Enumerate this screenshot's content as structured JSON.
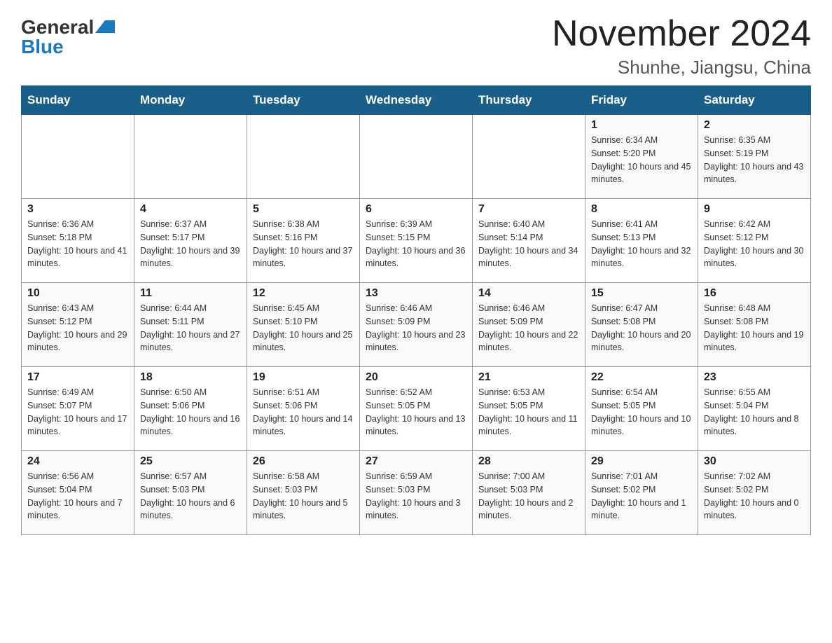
{
  "logo": {
    "general": "General",
    "blue": "Blue"
  },
  "header": {
    "month_year": "November 2024",
    "location": "Shunhe, Jiangsu, China"
  },
  "days_of_week": [
    "Sunday",
    "Monday",
    "Tuesday",
    "Wednesday",
    "Thursday",
    "Friday",
    "Saturday"
  ],
  "weeks": [
    [
      {
        "day": "",
        "info": ""
      },
      {
        "day": "",
        "info": ""
      },
      {
        "day": "",
        "info": ""
      },
      {
        "day": "",
        "info": ""
      },
      {
        "day": "",
        "info": ""
      },
      {
        "day": "1",
        "info": "Sunrise: 6:34 AM\nSunset: 5:20 PM\nDaylight: 10 hours and 45 minutes."
      },
      {
        "day": "2",
        "info": "Sunrise: 6:35 AM\nSunset: 5:19 PM\nDaylight: 10 hours and 43 minutes."
      }
    ],
    [
      {
        "day": "3",
        "info": "Sunrise: 6:36 AM\nSunset: 5:18 PM\nDaylight: 10 hours and 41 minutes."
      },
      {
        "day": "4",
        "info": "Sunrise: 6:37 AM\nSunset: 5:17 PM\nDaylight: 10 hours and 39 minutes."
      },
      {
        "day": "5",
        "info": "Sunrise: 6:38 AM\nSunset: 5:16 PM\nDaylight: 10 hours and 37 minutes."
      },
      {
        "day": "6",
        "info": "Sunrise: 6:39 AM\nSunset: 5:15 PM\nDaylight: 10 hours and 36 minutes."
      },
      {
        "day": "7",
        "info": "Sunrise: 6:40 AM\nSunset: 5:14 PM\nDaylight: 10 hours and 34 minutes."
      },
      {
        "day": "8",
        "info": "Sunrise: 6:41 AM\nSunset: 5:13 PM\nDaylight: 10 hours and 32 minutes."
      },
      {
        "day": "9",
        "info": "Sunrise: 6:42 AM\nSunset: 5:12 PM\nDaylight: 10 hours and 30 minutes."
      }
    ],
    [
      {
        "day": "10",
        "info": "Sunrise: 6:43 AM\nSunset: 5:12 PM\nDaylight: 10 hours and 29 minutes."
      },
      {
        "day": "11",
        "info": "Sunrise: 6:44 AM\nSunset: 5:11 PM\nDaylight: 10 hours and 27 minutes."
      },
      {
        "day": "12",
        "info": "Sunrise: 6:45 AM\nSunset: 5:10 PM\nDaylight: 10 hours and 25 minutes."
      },
      {
        "day": "13",
        "info": "Sunrise: 6:46 AM\nSunset: 5:09 PM\nDaylight: 10 hours and 23 minutes."
      },
      {
        "day": "14",
        "info": "Sunrise: 6:46 AM\nSunset: 5:09 PM\nDaylight: 10 hours and 22 minutes."
      },
      {
        "day": "15",
        "info": "Sunrise: 6:47 AM\nSunset: 5:08 PM\nDaylight: 10 hours and 20 minutes."
      },
      {
        "day": "16",
        "info": "Sunrise: 6:48 AM\nSunset: 5:08 PM\nDaylight: 10 hours and 19 minutes."
      }
    ],
    [
      {
        "day": "17",
        "info": "Sunrise: 6:49 AM\nSunset: 5:07 PM\nDaylight: 10 hours and 17 minutes."
      },
      {
        "day": "18",
        "info": "Sunrise: 6:50 AM\nSunset: 5:06 PM\nDaylight: 10 hours and 16 minutes."
      },
      {
        "day": "19",
        "info": "Sunrise: 6:51 AM\nSunset: 5:06 PM\nDaylight: 10 hours and 14 minutes."
      },
      {
        "day": "20",
        "info": "Sunrise: 6:52 AM\nSunset: 5:05 PM\nDaylight: 10 hours and 13 minutes."
      },
      {
        "day": "21",
        "info": "Sunrise: 6:53 AM\nSunset: 5:05 PM\nDaylight: 10 hours and 11 minutes."
      },
      {
        "day": "22",
        "info": "Sunrise: 6:54 AM\nSunset: 5:05 PM\nDaylight: 10 hours and 10 minutes."
      },
      {
        "day": "23",
        "info": "Sunrise: 6:55 AM\nSunset: 5:04 PM\nDaylight: 10 hours and 8 minutes."
      }
    ],
    [
      {
        "day": "24",
        "info": "Sunrise: 6:56 AM\nSunset: 5:04 PM\nDaylight: 10 hours and 7 minutes."
      },
      {
        "day": "25",
        "info": "Sunrise: 6:57 AM\nSunset: 5:03 PM\nDaylight: 10 hours and 6 minutes."
      },
      {
        "day": "26",
        "info": "Sunrise: 6:58 AM\nSunset: 5:03 PM\nDaylight: 10 hours and 5 minutes."
      },
      {
        "day": "27",
        "info": "Sunrise: 6:59 AM\nSunset: 5:03 PM\nDaylight: 10 hours and 3 minutes."
      },
      {
        "day": "28",
        "info": "Sunrise: 7:00 AM\nSunset: 5:03 PM\nDaylight: 10 hours and 2 minutes."
      },
      {
        "day": "29",
        "info": "Sunrise: 7:01 AM\nSunset: 5:02 PM\nDaylight: 10 hours and 1 minute."
      },
      {
        "day": "30",
        "info": "Sunrise: 7:02 AM\nSunset: 5:02 PM\nDaylight: 10 hours and 0 minutes."
      }
    ]
  ]
}
